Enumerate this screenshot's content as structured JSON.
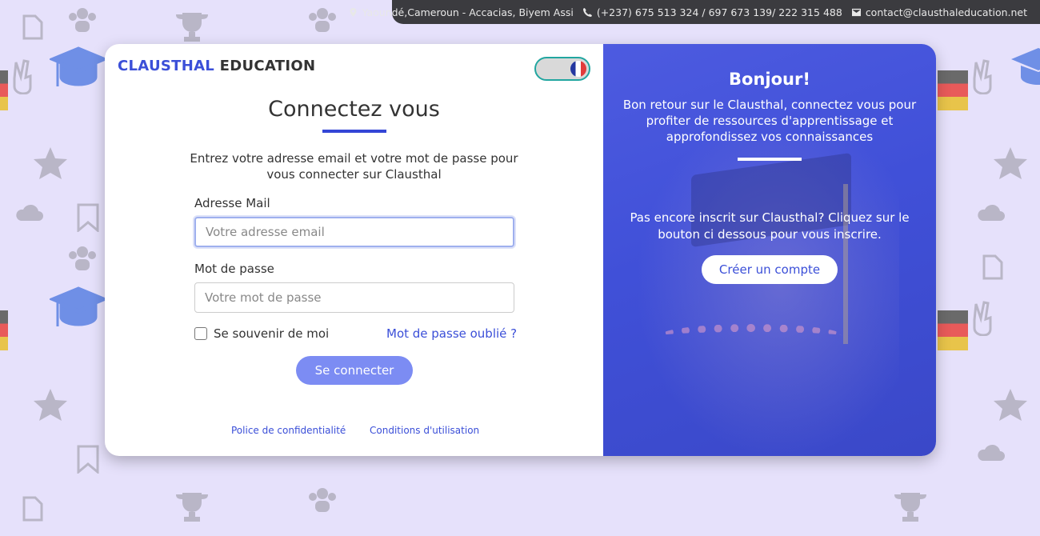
{
  "topbar": {
    "address": "Yaoundé,Cameroun - Accacias, Biyem Assi",
    "phone": "(+237) 675 513 324 / 697 673 139/ 222 315 488",
    "email": "contact@clausthaleducation.net"
  },
  "brand": {
    "part1": "CLAUSTHAL",
    "part2": "EDUCATION"
  },
  "language_toggle": {
    "current_flag": "france-flag-icon"
  },
  "login": {
    "title": "Connectez vous",
    "intro": "Entrez votre adresse email et votre mot de passe pour vous connecter sur Clausthal",
    "email_label": "Adresse Mail",
    "email_placeholder": "Votre adresse email",
    "email_value": "",
    "password_label": "Mot de passe",
    "password_placeholder": "Votre mot de passe",
    "password_value": "",
    "remember_label": "Se souvenir de moi",
    "remember_checked": false,
    "forgot_link": "Mot de passe oublié ?",
    "submit_label": "Se connecter"
  },
  "footer": {
    "privacy": "Police de confidentialité",
    "terms": "Conditions d'utilisation"
  },
  "welcome": {
    "title": "Bonjour!",
    "text": "Bon retour sur le Clausthal, connectez vous pour profiter de ressources d'apprentissage et approfondissez vos connaissances",
    "signup_prompt": "Pas encore inscrit sur Clausthal? Cliquez sur le bouton ci dessous pour vous inscrire.",
    "signup_button": "Créer un compte"
  },
  "colors": {
    "accent": "#3b4fd8",
    "submit_bg": "#7c8cf3",
    "panel_bg": "#4552dc",
    "page_bg": "#e6e1fb",
    "topbar_bg": "#3b3b3f"
  }
}
